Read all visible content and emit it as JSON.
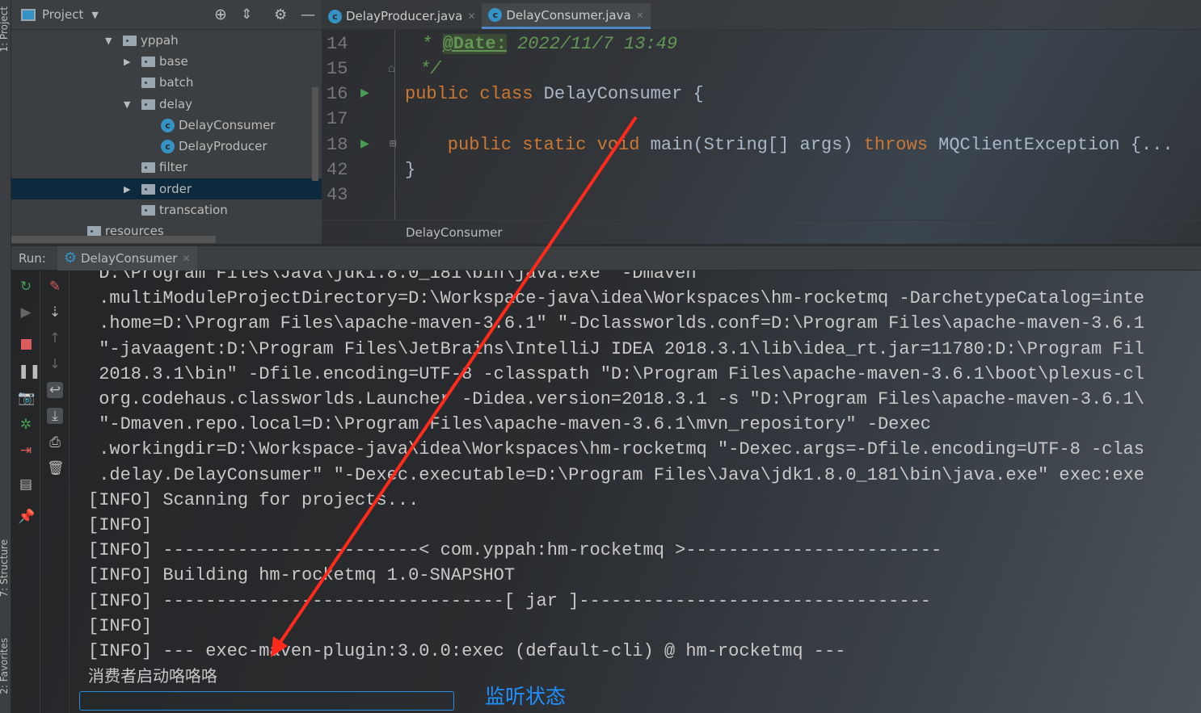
{
  "side_tabs": {
    "project": "1: Project",
    "structure": "7: Structure",
    "favorites": "2: Favorites"
  },
  "project": {
    "title": "Project",
    "icons": [
      "locate-icon",
      "collapse-icon",
      "gear-icon",
      "minimize-icon"
    ],
    "tree": [
      {
        "label": "yppah",
        "type": "folder",
        "expanded": true
      },
      {
        "label": "base",
        "type": "folder",
        "expanded": false
      },
      {
        "label": "batch",
        "type": "folder"
      },
      {
        "label": "delay",
        "type": "folder",
        "expanded": true
      },
      {
        "label": "DelayConsumer",
        "type": "class"
      },
      {
        "label": "DelayProducer",
        "type": "class"
      },
      {
        "label": "filter",
        "type": "folder"
      },
      {
        "label": "order",
        "type": "folder",
        "expanded": false,
        "selected": true
      },
      {
        "label": "transcation",
        "type": "folder"
      },
      {
        "label": "resources",
        "type": "resources"
      }
    ]
  },
  "editor": {
    "tabs": [
      {
        "label": "DelayProducer.java",
        "active": false
      },
      {
        "label": "DelayConsumer.java",
        "active": true
      }
    ],
    "lines": [
      {
        "n": "14",
        "star": " * ",
        "tag": "@Date:",
        "comment": " 2022/11/7 13:49"
      },
      {
        "n": "15",
        "comment": " */"
      },
      {
        "n": "16",
        "kw": "public class ",
        "text": "DelayConsumer {"
      },
      {
        "n": "17"
      },
      {
        "n": "18",
        "kw": "    public static void ",
        "text": "main(String[] args) ",
        "kw2": "throws ",
        "text2": "MQClientException {..."
      },
      {
        "n": "42",
        "text": "}"
      },
      {
        "n": "43"
      }
    ],
    "breadcrumb": "DelayConsumer"
  },
  "run": {
    "label": "Run:",
    "tab": "DelayConsumer"
  },
  "console": {
    "lines": [
      "\"D:\\Program Files\\Java\\jdk1.8.0_181\\bin\\java.exe\" -Dmaven",
      " .multiModuleProjectDirectory=D:\\Workspace-java\\idea\\Workspaces\\hm-rocketmq -DarchetypeCatalog=inte",
      " .home=D:\\Program Files\\apache-maven-3.6.1\" \"-Dclassworlds.conf=D:\\Program Files\\apache-maven-3.6.1",
      " \"-javaagent:D:\\Program Files\\JetBrains\\IntelliJ IDEA 2018.3.1\\lib\\idea_rt.jar=11780:D:\\Program Fil",
      " 2018.3.1\\bin\" -Dfile.encoding=UTF-8 -classpath \"D:\\Program Files\\apache-maven-3.6.1\\boot\\plexus-cl",
      " org.codehaus.classworlds.Launcher -Didea.version=2018.3.1 -s \"D:\\Program Files\\apache-maven-3.6.1\\",
      " \"-Dmaven.repo.local=D:\\Program Files\\apache-maven-3.6.1\\mvn_repository\" -Dexec",
      " .workingdir=D:\\Workspace-java\\idea\\Workspaces\\hm-rocketmq \"-Dexec.args=-Dfile.encoding=UTF-8 -clas",
      " .delay.DelayConsumer\" \"-Dexec.executable=D:\\Program Files\\Java\\jdk1.8.0_181\\bin\\java.exe\" exec:exe",
      "[INFO] Scanning for projects...",
      "[INFO]",
      "[INFO] ------------------------< com.yppah:hm-rocketmq >------------------------",
      "[INFO] Building hm-rocketmq 1.0-SNAPSHOT",
      "[INFO] --------------------------------[ jar ]---------------------------------",
      "[INFO]",
      "[INFO] --- exec-maven-plugin:3.0.0:exec (default-cli) @ hm-rocketmq ---",
      "消费者启动咯咯咯"
    ]
  },
  "annotation": {
    "text": "监听状态",
    "color": "#1e90ff",
    "arrow_color": "#ff2a1a"
  }
}
